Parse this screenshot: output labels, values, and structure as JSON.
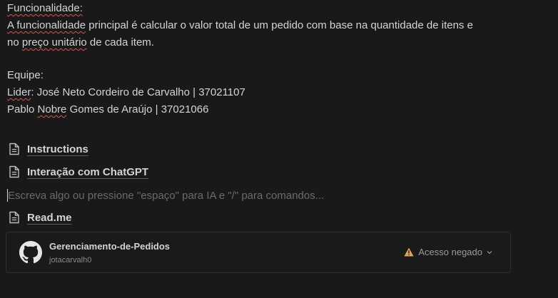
{
  "description_block": {
    "heading": "Funcionalidade:",
    "line1": {
      "squiggled": "A funcionalidade",
      "rest": " principal é calcular o valor total de um pedido com base na quantidade de itens e"
    },
    "line2": {
      "before": "no ",
      "squiggled": "preço unitário",
      "after": " de cada item."
    }
  },
  "team_block": {
    "heading": "Equipe:",
    "leader": {
      "squiggled": "Lider",
      "rest": ": José Neto Cordeiro de Carvalho | 37021107"
    },
    "member": {
      "before": "Pablo ",
      "squiggled": "Nobre",
      "after": " Gomes de Araújo | 37021066"
    }
  },
  "pages": [
    {
      "label": "Instructions",
      "icon": "page-icon"
    },
    {
      "label": "Interação com ChatGPT",
      "icon": "page-icon"
    },
    {
      "label": "Read.me",
      "icon": "page-icon"
    }
  ],
  "editor": {
    "placeholder": "Escreva algo ou pressione \"espaço\" para IA e \"/\" para comandos..."
  },
  "github_embed": {
    "repo_name": "Gerenciamento-de-Pedidos",
    "owner": "jotacarvalh0",
    "access_label": "Acesso negado",
    "icon": "github-icon",
    "warning_color": "#e0a15b"
  }
}
